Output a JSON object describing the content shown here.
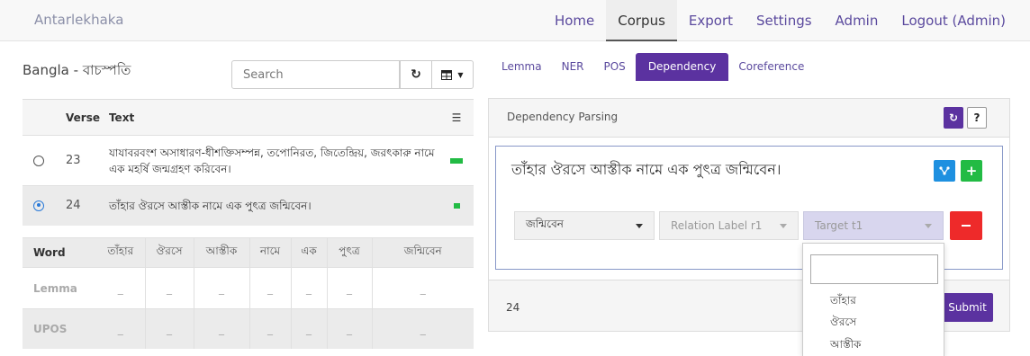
{
  "nav": {
    "brand": "Antarlekhaka",
    "links": [
      "Home",
      "Corpus",
      "Export",
      "Settings",
      "Admin",
      "Logout (Admin)"
    ],
    "active": "Corpus"
  },
  "corpus": {
    "title": "Bangla - বাচস্পতি",
    "search_placeholder": "Search",
    "columns": {
      "verse": "Verse",
      "text": "Text"
    },
    "rows": [
      {
        "verse": "23",
        "text": "যাযাবরবংশ অসাধারণ-ধীশক্তিসম্পন্ন, তপোনিরত, জিতেন্দ্রিয়, জরৎকারু নামে এক মহর্ষি জন্মগ্রহণ করিবেন।",
        "selected": false,
        "progress": 1.0
      },
      {
        "verse": "24",
        "text": "তাঁহার ঔরসে আস্তীক নামে এক পুৎত্র জন্মিবেন।",
        "selected": true,
        "progress": 0.5
      }
    ]
  },
  "words": {
    "header_label": "Word",
    "tokens": [
      "তাঁহার",
      "ঔরসে",
      "আস্তীক",
      "নামে",
      "এক",
      "পুৎত্র",
      "জন্মিবেন"
    ],
    "lemma_label": "Lemma",
    "upos_label": "UPOS",
    "placeholder": "_"
  },
  "tabs": {
    "items": [
      "Lemma",
      "NER",
      "POS",
      "Dependency",
      "Coreference"
    ],
    "active": "Dependency"
  },
  "dependency": {
    "panel_title": "Dependency Parsing",
    "help_label": "?",
    "sentence": "তাঁহার ঔরসে আস্তীক নামে এক পুৎত্র জন্মিবেন।",
    "source_select": "জন্মিবেন",
    "relation_placeholder": "Relation Label r1",
    "target_placeholder": "Target t1",
    "footer_verse": "24",
    "submit_label": "Submit",
    "dropdown_options": [
      "তাঁহার",
      "ঔরসে",
      "আস্তীক"
    ]
  },
  "colors": {
    "primary": "#5b32a0",
    "success": "#22bb44",
    "danger": "#ee2a2a",
    "info": "#1e90e0",
    "link": "#5b4a9e"
  },
  "icons": {
    "refresh": "refresh-icon",
    "columns": "table-columns-icon",
    "list_check": "list-check-icon",
    "tree": "tree-icon",
    "plus": "plus-icon",
    "minus": "minus-icon",
    "caret": "caret-down-icon",
    "radio": "radio-icon"
  }
}
